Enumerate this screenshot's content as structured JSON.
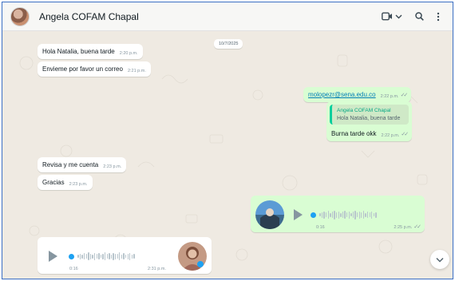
{
  "header": {
    "contact_name": "Angela COFAM Chapal",
    "icons": [
      "video-call-icon",
      "chevron-down-icon",
      "search-icon",
      "menu-icon"
    ]
  },
  "date_chip": "10/7/2025",
  "messages": [
    {
      "direction": "in",
      "text": "Hola Natalia, buena tarde",
      "time": "2:20 p.m."
    },
    {
      "direction": "in",
      "text": "Envieme por favor un correo",
      "time": "2:21 p.m."
    },
    {
      "direction": "out",
      "text": "molopezr@sena.edu.co",
      "time": "2:22 p.m.",
      "status": "read"
    },
    {
      "direction": "out",
      "quote_name": "Angela COFAM Chapal",
      "quote_text": "Hola Natalia, buena tarde",
      "text": "Burna tarde okk",
      "time": "2:22 p.m.",
      "status": "read"
    },
    {
      "direction": "in",
      "text": "Revisa y me cuenta",
      "time": "2:23 p.m."
    },
    {
      "direction": "in",
      "text": "Gracias",
      "time": "2:23 p.m."
    },
    {
      "direction": "out",
      "type": "voice",
      "duration": "0:16",
      "time": "2:25 p.m.",
      "status": "read"
    },
    {
      "direction": "in",
      "type": "voice",
      "duration": "0:16",
      "time": "2:31 p.m."
    }
  ],
  "colors": {
    "outgoing_bubble": "#d9fdd3",
    "incoming_bubble": "#ffffff",
    "wallpaper": "#efeae2",
    "accent": "#06cf9c"
  }
}
